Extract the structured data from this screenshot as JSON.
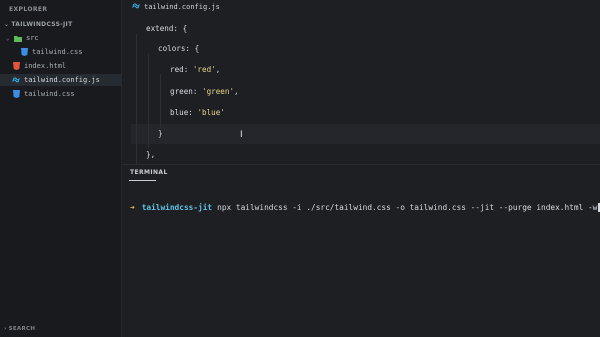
{
  "sidebar": {
    "title": "EXPLORER",
    "folder": "TAILWINDCSS-JIT",
    "items": [
      {
        "label": "src",
        "type": "folder",
        "icon": "folder-open-icon"
      },
      {
        "label": "tailwind.css",
        "type": "css",
        "icon": "css-file-icon"
      },
      {
        "label": "index.html",
        "type": "html",
        "icon": "html-file-icon"
      },
      {
        "label": "tailwind.config.js",
        "type": "tailwind",
        "icon": "tailwind-file-icon"
      },
      {
        "label": "tailwind.css",
        "type": "css",
        "icon": "css-file-icon"
      }
    ],
    "search_label": "SEARCH"
  },
  "editor": {
    "tab_label": "tailwind.config.js",
    "lines": {
      "l1": "extend: {",
      "l2": "colors: {",
      "l3_key": "red: ",
      "l3_val": "'red'",
      "l3_end": ",",
      "l4_key": "green: ",
      "l4_val": "'green'",
      "l4_end": ",",
      "l5_key": "blue: ",
      "l5_val": "'blue'",
      "l6": "}",
      "l7": "},"
    }
  },
  "terminal": {
    "tab_label": "TERMINAL",
    "prompt_symbol": "➜",
    "directory": "tailwindcss-jit",
    "command": "npx tailwindcss -i ./src/tailwind.css -o tailwind.css --jit --purge index.html -w"
  },
  "colors": {
    "background": "#1e1f22",
    "sidebar": "#191a1d",
    "string": "#e6d58b",
    "prompt_arrow": "#e6c84a",
    "prompt_dir": "#62c2e6"
  }
}
